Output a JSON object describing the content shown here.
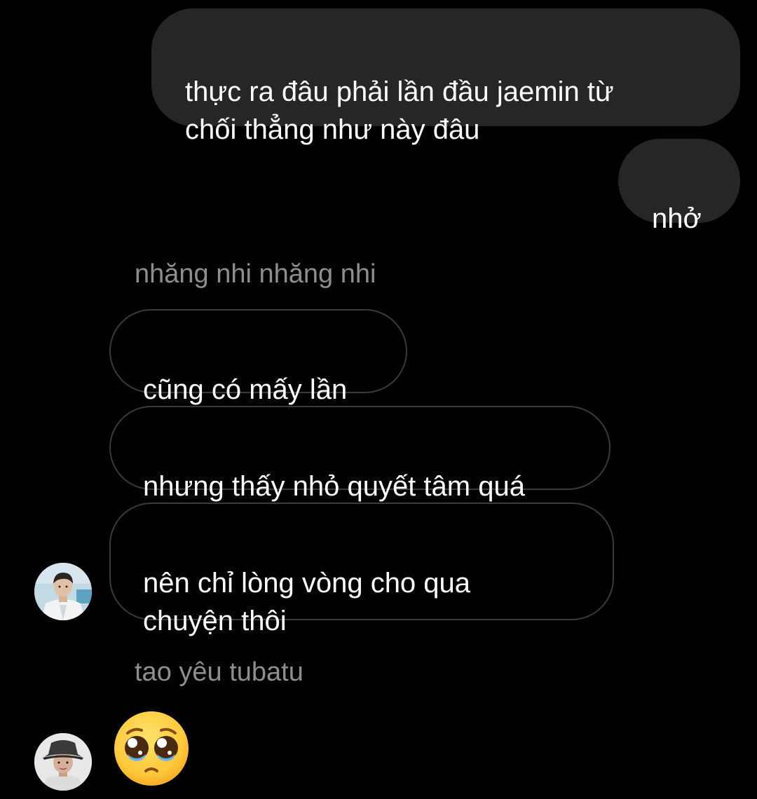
{
  "messages": [
    {
      "direction": "outgoing",
      "text": "thực ra đâu phải lần đầu jaemin từ\nchối thẳng như này đâu"
    },
    {
      "direction": "outgoing",
      "text": "nhở"
    },
    {
      "direction": "incoming",
      "text": "cũng có mấy lần"
    },
    {
      "direction": "incoming",
      "text": "nhưng thấy nhỏ quyết tâm quá"
    },
    {
      "direction": "incoming",
      "text": "nên chỉ lòng vòng cho qua\nchuyện thôi"
    },
    {
      "direction": "incoming",
      "emoji": "pleading-face-emoji"
    }
  ],
  "senders": [
    {
      "name": "nhăng nhi nhăng nhi",
      "avatar": "user-photo-avatar"
    },
    {
      "name": "tao yêu tubatu",
      "avatar": "user-photo-avatar-bucket-hat"
    }
  ],
  "colors": {
    "background": "#000000",
    "outgoing_bubble": "#262626",
    "incoming_border": "#3a3a3a",
    "sender_name": "#8e8e8e",
    "text": "#ffffff"
  }
}
